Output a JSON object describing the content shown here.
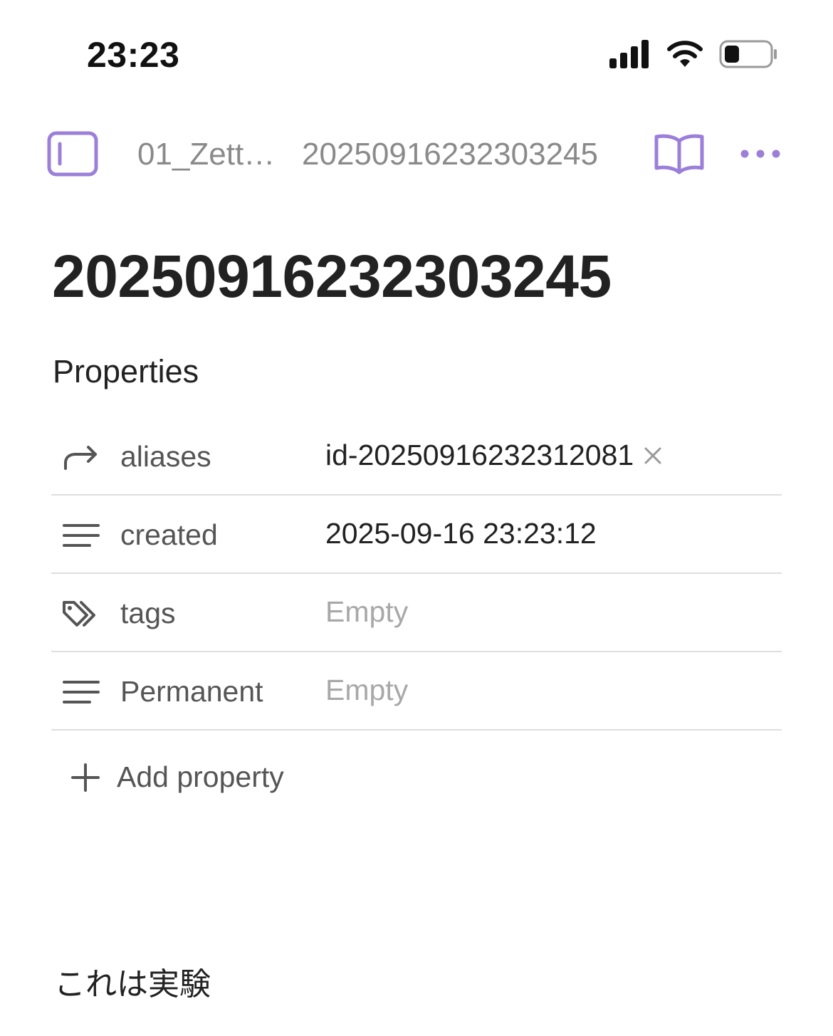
{
  "status_bar": {
    "time": "23:23",
    "icons": [
      "cellular-signal-icon",
      "wifi-icon",
      "battery-icon"
    ]
  },
  "nav": {
    "breadcrumb_folder": "01_Zettelkasten",
    "breadcrumb_note": "20250916232303245",
    "icons": [
      "sidebar-toggle-icon",
      "book-open-icon",
      "more-horizontal-icon"
    ],
    "accent_color": "#9b7fd9"
  },
  "note": {
    "title": "20250916232303245",
    "properties_heading": "Properties",
    "properties": [
      {
        "key": "aliases",
        "value": "id-20250916232312081",
        "icon": "forward-arrow-icon",
        "empty": false,
        "removable": true
      },
      {
        "key": "created",
        "value": "2025-09-16 23:23:12",
        "icon": "text-lines-icon",
        "empty": false,
        "removable": false
      },
      {
        "key": "tags",
        "value": "Empty",
        "icon": "tags-icon",
        "empty": true,
        "removable": false
      },
      {
        "key": "Permanent",
        "value": "Empty",
        "icon": "text-lines-icon",
        "empty": true,
        "removable": false
      }
    ],
    "add_property_label": "Add property",
    "body": "これは実験"
  }
}
